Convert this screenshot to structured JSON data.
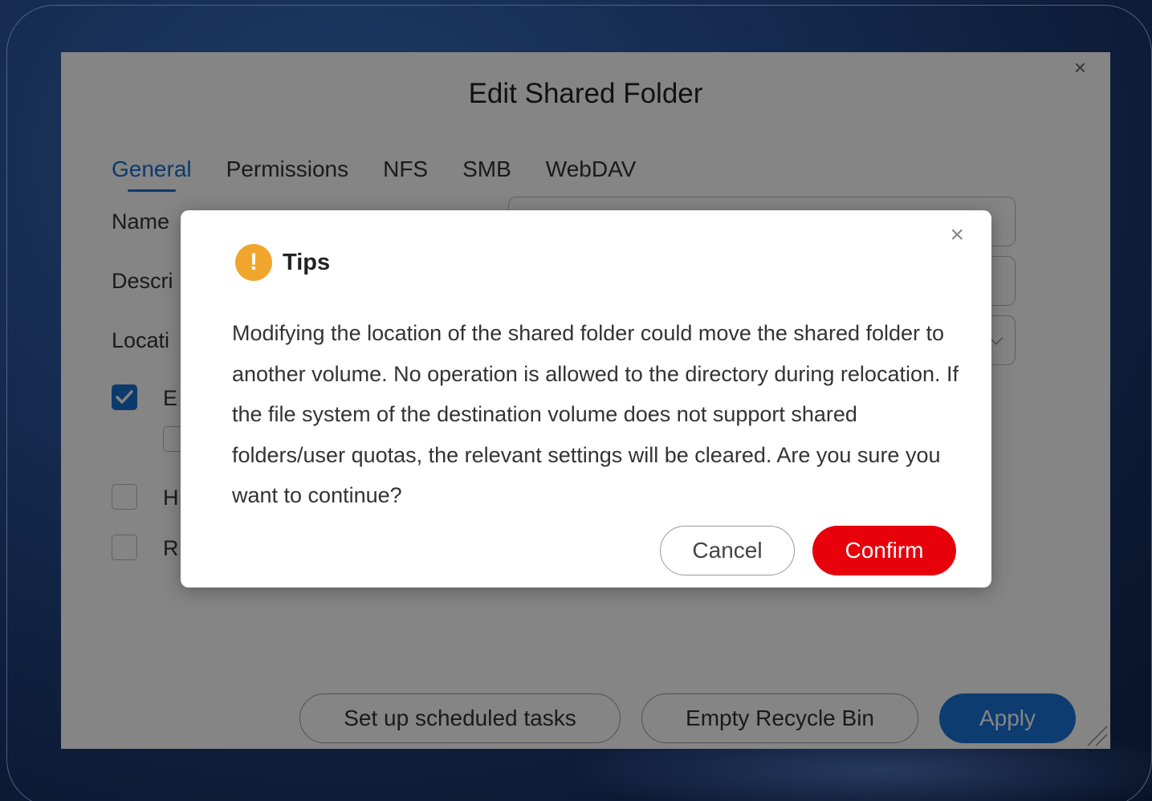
{
  "window": {
    "title": "Edit Shared Folder",
    "close_glyph": "×",
    "tabs": [
      {
        "label": "General",
        "active": true
      },
      {
        "label": "Permissions",
        "active": false
      },
      {
        "label": "NFS",
        "active": false
      },
      {
        "label": "SMB",
        "active": false
      },
      {
        "label": "WebDAV",
        "active": false
      }
    ],
    "fields": {
      "name_label": "Name",
      "description_label": "Descri",
      "location_label": "Locati"
    },
    "checkboxes": [
      {
        "label": "E",
        "checked": true
      },
      {
        "label": "H",
        "checked": false
      },
      {
        "label": "R",
        "checked": false
      }
    ],
    "buttons": {
      "scheduled_tasks": "Set up scheduled tasks",
      "empty_recycle_bin": "Empty Recycle Bin",
      "apply": "Apply"
    },
    "colors": {
      "accent": "#1a6fd0",
      "apply": "#1a74d6"
    }
  },
  "dialog": {
    "title": "Tips",
    "icon": "warning-icon",
    "icon_glyph": "!",
    "close_glyph": "×",
    "message": "Modifying the location of the shared folder could move the shared folder to another volume. No operation is allowed to the directory during relocation. If the file system of the destination volume does not support shared folders/user quotas, the relevant settings will be cleared. Are you sure you want to continue?",
    "cancel_label": "Cancel",
    "confirm_label": "Confirm",
    "colors": {
      "confirm": "#e8000b",
      "warning": "#f0a52c"
    }
  }
}
